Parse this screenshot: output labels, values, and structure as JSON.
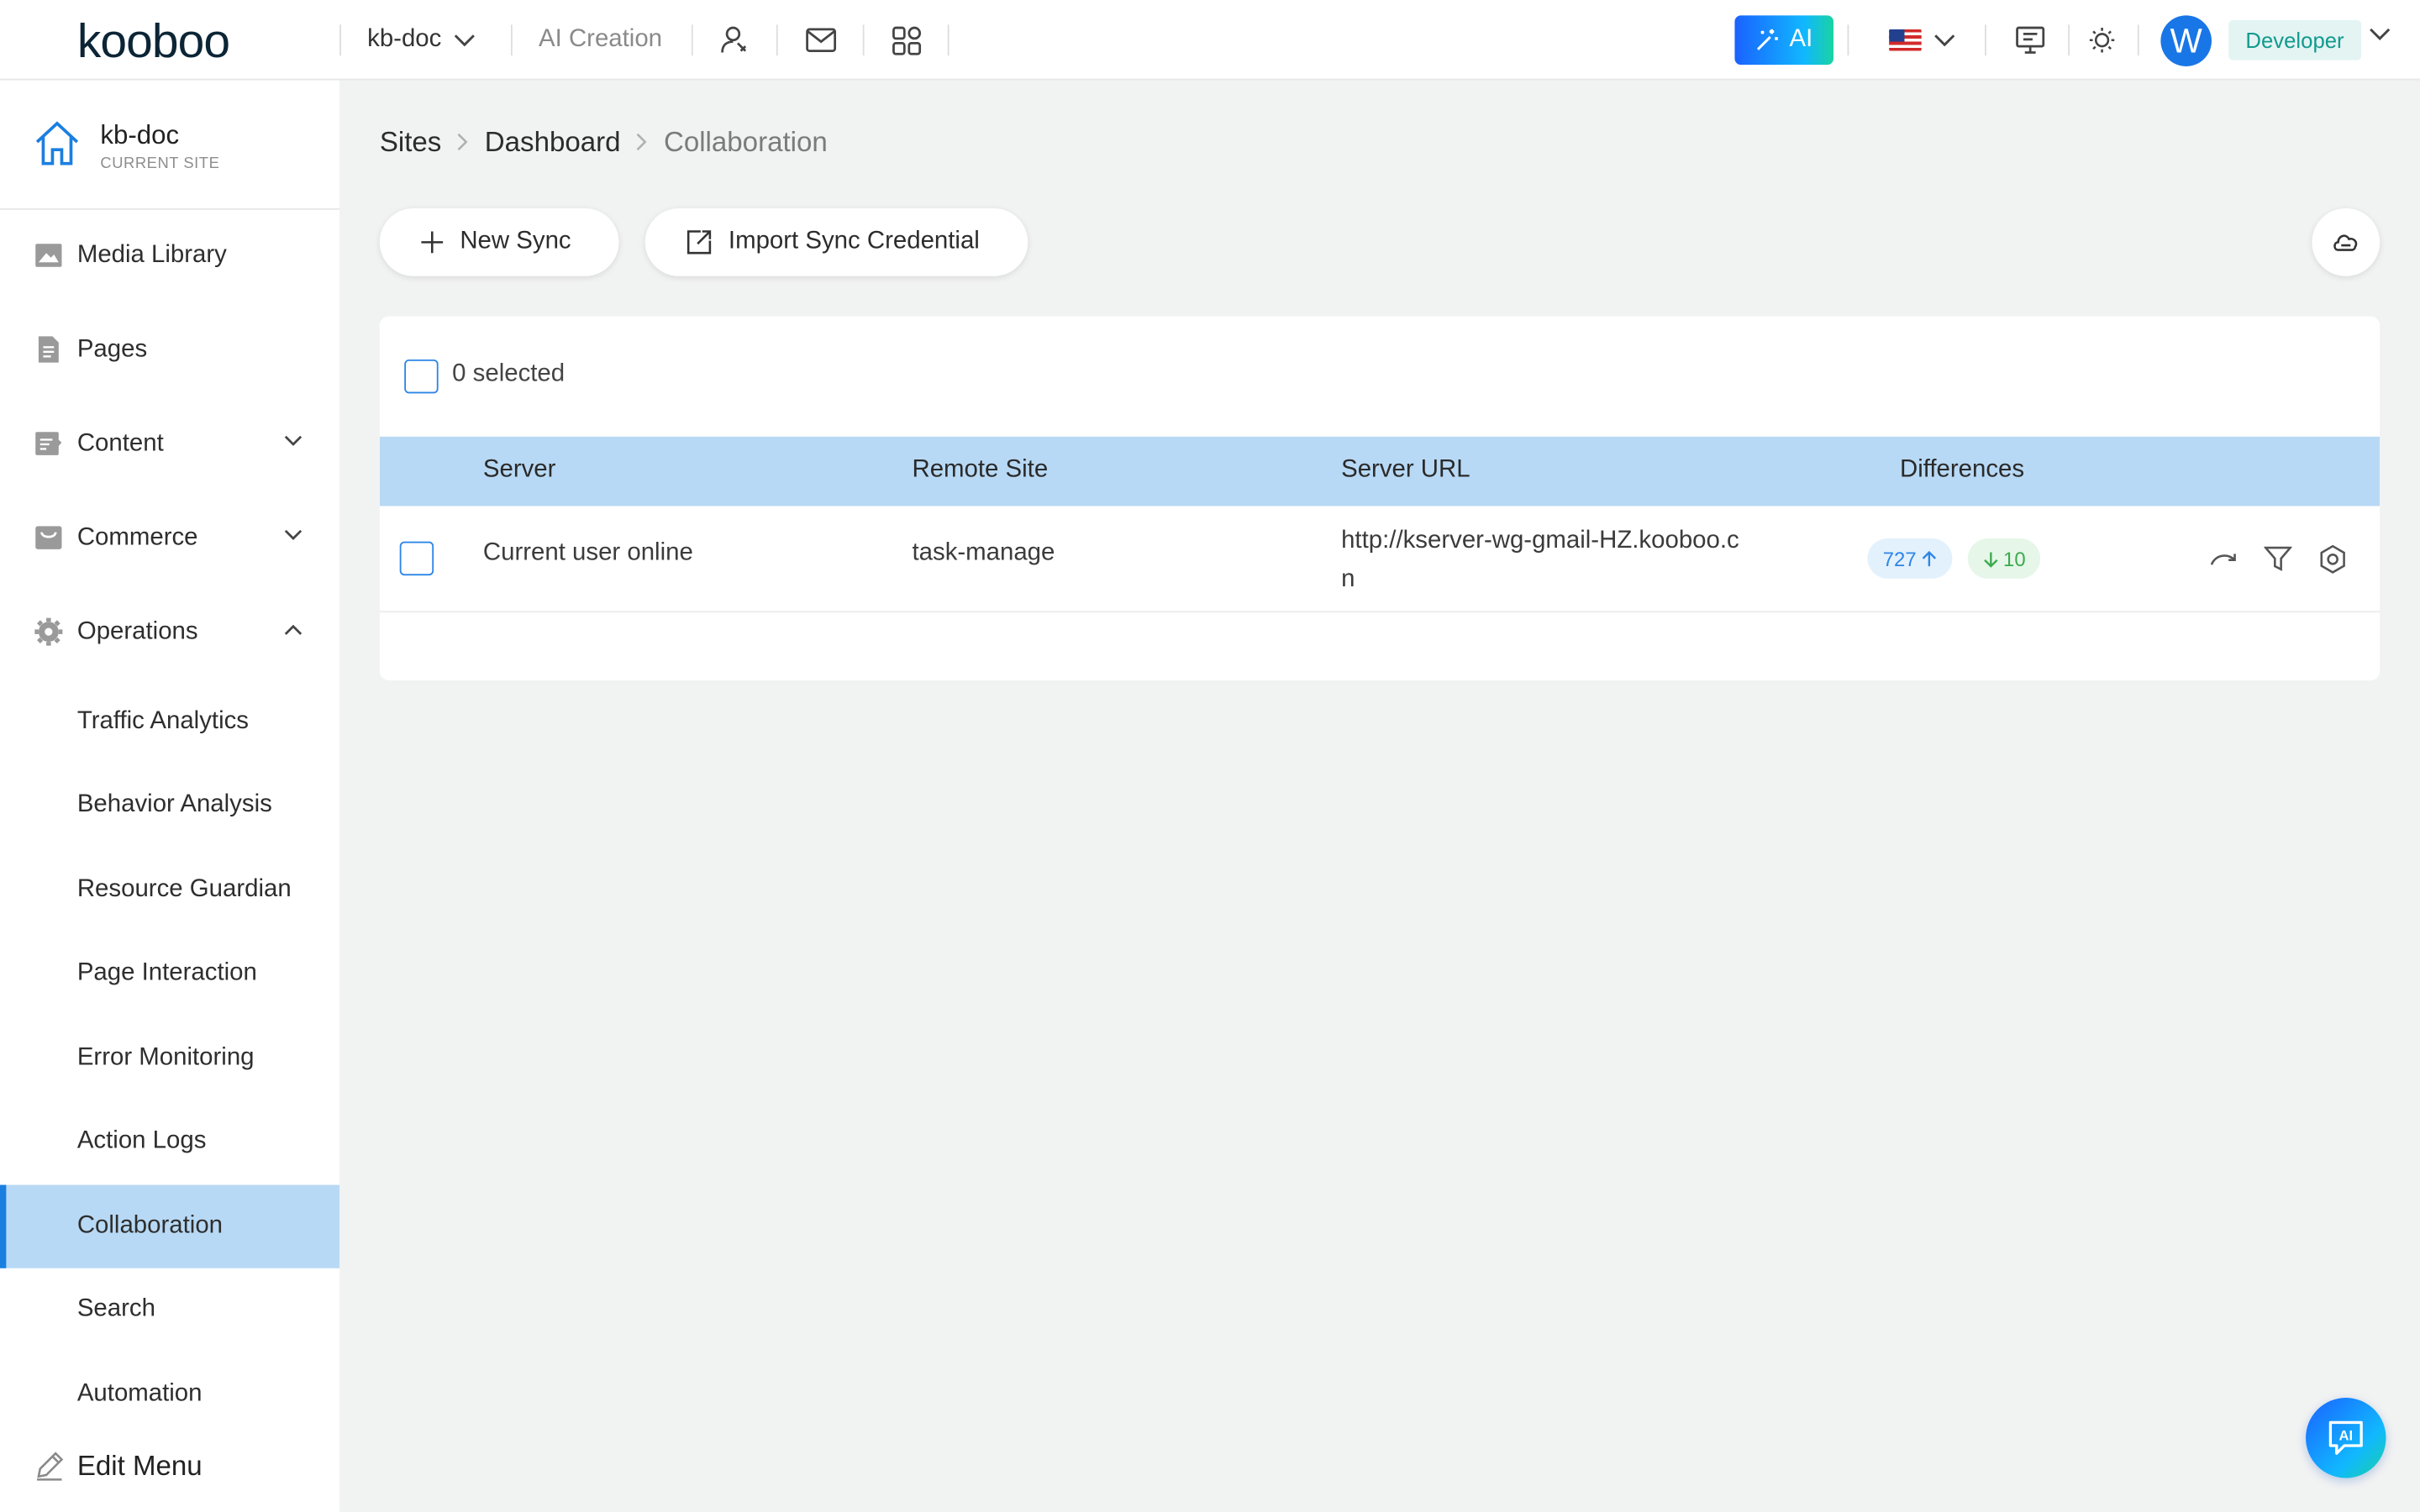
{
  "topbar": {
    "logo_text": "kooboo",
    "site_name": "kb-doc",
    "ai_creation": "AI Creation",
    "ai_button": "AI",
    "avatar_letter": "W",
    "role": "Developer"
  },
  "sidebar": {
    "current_site": {
      "name": "kb-doc",
      "label": "CURRENT SITE"
    },
    "items": [
      {
        "label": "Media Library",
        "icon": "image-icon"
      },
      {
        "label": "Pages",
        "icon": "page-icon"
      },
      {
        "label": "Content",
        "icon": "content-icon",
        "expandable": true
      },
      {
        "label": "Commerce",
        "icon": "commerce-icon",
        "expandable": true
      },
      {
        "label": "Operations",
        "icon": "gear-icon",
        "expanded": true
      }
    ],
    "operations": [
      {
        "label": "Traffic Analytics"
      },
      {
        "label": "Behavior Analysis"
      },
      {
        "label": "Resource Guardian"
      },
      {
        "label": "Page Interaction"
      },
      {
        "label": "Error Monitoring"
      },
      {
        "label": "Action Logs"
      },
      {
        "label": "Collaboration",
        "active": true
      },
      {
        "label": "Search"
      },
      {
        "label": "Automation"
      }
    ],
    "edit_menu": "Edit Menu"
  },
  "breadcrumb": [
    "Sites",
    "Dashboard",
    "Collaboration"
  ],
  "toolbar": {
    "new_sync": "New Sync",
    "import_credential": "Import Sync Credential"
  },
  "table": {
    "selected_text": "0 selected",
    "columns": [
      "Server",
      "Remote Site",
      "Server URL",
      "Differences"
    ],
    "rows": [
      {
        "server": "Current user online",
        "remote_site": "task-manage",
        "server_url": "http://kserver-wg-gmail-HZ.kooboo.cn",
        "diff_up": "727",
        "diff_down": "10"
      }
    ]
  },
  "floating": {
    "label": "AI"
  },
  "colors": {
    "accent": "#1b7fe0",
    "active_row": "#b8d9f5",
    "role_bg": "#e3f4f3",
    "role_text": "#139a8e"
  }
}
